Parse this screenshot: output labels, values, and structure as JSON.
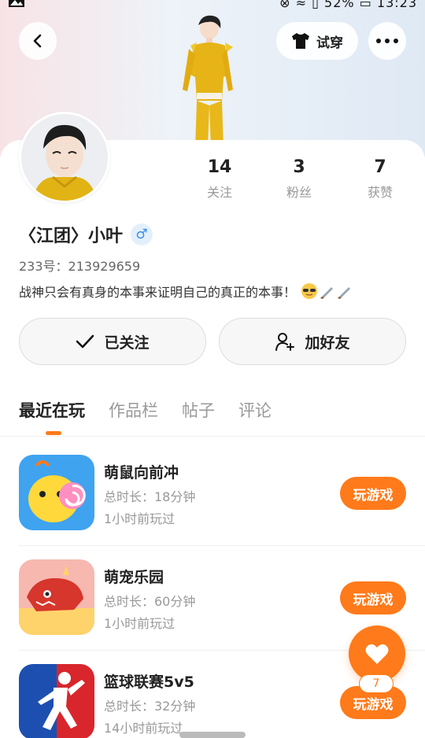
{
  "status": {
    "battery": "52%",
    "time": "13:23"
  },
  "header": {
    "try_on_label": "试穿"
  },
  "profile": {
    "name": "〈江团〉小叶",
    "gender_symbol": "♂",
    "id_line": "233号：213929659",
    "bio": "战神只会有真身的本事来证明自己的真正的本事！",
    "stats": [
      {
        "value": "14",
        "label": "关注"
      },
      {
        "value": "3",
        "label": "粉丝"
      },
      {
        "value": "7",
        "label": "获赞"
      }
    ]
  },
  "actions": {
    "followed_label": "已关注",
    "add_friend_label": "加好友"
  },
  "tabs": [
    "最近在玩",
    "作品栏",
    "帖子",
    "评论"
  ],
  "games": [
    {
      "title": "萌鼠向前冲",
      "duration": "总时长：18分钟",
      "last_played": "1小时前玩过",
      "button": "玩游戏"
    },
    {
      "title": "萌宠乐园",
      "duration": "总时长：60分钟",
      "last_played": "1小时前玩过",
      "button": "玩游戏"
    },
    {
      "title": "篮球联赛5v5",
      "duration": "总时长：32分钟",
      "last_played": "14小时前玩过",
      "button": "玩游戏"
    }
  ],
  "like": {
    "count": "7"
  },
  "colors": {
    "accent": "#ff7a1a",
    "gender_blue": "#3a8ee6"
  }
}
